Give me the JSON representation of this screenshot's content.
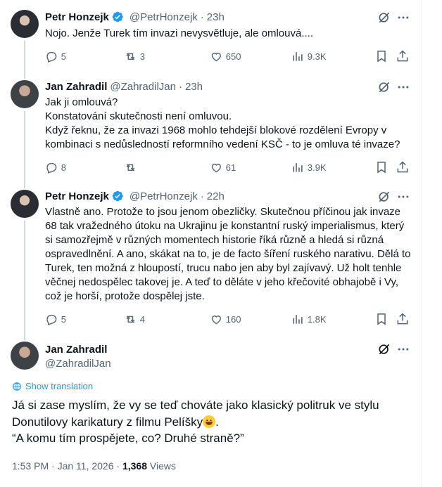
{
  "tweets": [
    {
      "name": "Petr Honzejk",
      "verified": true,
      "handle": "@PetrHonzejk",
      "time": "23h",
      "text": "Nojo. Jenže Turek tím invazi nevysvětluje, ale omlouvá....",
      "replies": "5",
      "reposts": "3",
      "likes": "650",
      "views": "9.3K"
    },
    {
      "name": "Jan Zahradil",
      "verified": false,
      "handle": "@ZahradilJan",
      "time": "23h",
      "lines": [
        "Jak ji omlouvá?",
        "Konstatování skutečnosti není omluvou.",
        "Když řeknu, že za invazi 1968 mohlo tehdejší blokové rozdělení Evropy v kombinaci s nedůsledností reformního vedení KSČ - to je omluva té invaze?"
      ],
      "replies": "8",
      "reposts": "",
      "likes": "61",
      "views": "3.9K"
    },
    {
      "name": "Petr Honzejk",
      "verified": true,
      "handle": "@PetrHonzejk",
      "time": "22h",
      "text": "Vlastně ano. Protože to jsou jenom obezličky. Skutečnou příčinou jak invaze 68 tak vražedného útoku na Ukrajinu je konstantní ruský imperialismus, který si samozřejmě v různých momentech historie říká různě a hledá si různá ospravedlnění. A ano, skákat na to, je de facto šíření ruského narativu. Dělá to Turek, ten možná z hloupostí, trucu nabo jen aby byl zajívavý. Už holt tenhle věčnej nedospělec takovej je. A teď to děláte v jeho křečovité obhajobě i Vy, což je horší, protože dospělej jste.",
      "replies": "5",
      "reposts": "4",
      "likes": "160",
      "views": "1.8K"
    }
  ],
  "main": {
    "name": "Jan Zahradil",
    "handle": "@ZahradilJan",
    "show_translation": "Show translation",
    "line1a": "Já si zase myslím, že vy se teď chováte jako klasický politruk ve stylu Donutilovy karikatury z filmu Pelíšky",
    "line1b": ".",
    "line2": "“A komu tím prospějete, co? Druhé straně?”",
    "time": "1:53 PM · Jan 11, 2026 · ",
    "views_count": "1,368",
    "views_label": " Views"
  },
  "colors": {
    "text": "#0f1419",
    "secondary": "#536471",
    "accent": "#1d9bf0",
    "verified": "#1d9bf0",
    "thread_line": "#cfd9de"
  },
  "icons": [
    "verified-badge-icon",
    "grok-icon",
    "more-icon",
    "reply-icon",
    "repost-icon",
    "like-icon",
    "views-icon",
    "bookmark-icon",
    "share-icon",
    "translate-icon",
    "smiley-emoji"
  ]
}
